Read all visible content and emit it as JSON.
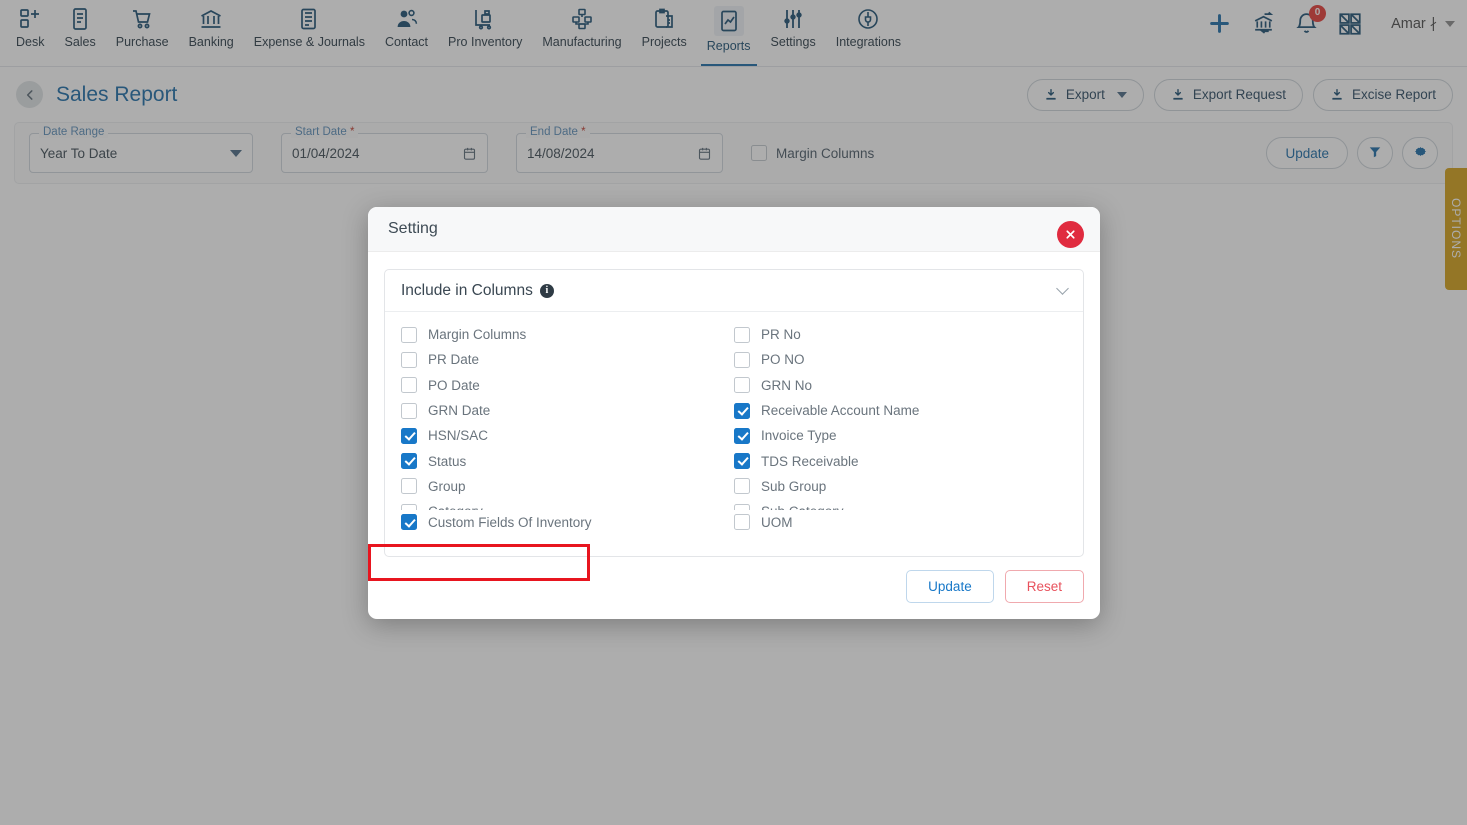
{
  "topnav": {
    "items": [
      {
        "label": "Desk",
        "icon": "desk-icon",
        "active": false
      },
      {
        "label": "Sales",
        "icon": "sales-icon",
        "active": false
      },
      {
        "label": "Purchase",
        "icon": "purchase-cart-icon",
        "active": false
      },
      {
        "label": "Banking",
        "icon": "bank-icon",
        "active": false
      },
      {
        "label": "Expense & Journals",
        "icon": "journal-icon",
        "active": false
      },
      {
        "label": "Contact",
        "icon": "contact-people-icon",
        "active": false
      },
      {
        "label": "Pro Inventory",
        "icon": "inventory-trolley-icon",
        "active": false
      },
      {
        "label": "Manufacturing",
        "icon": "manufacturing-icon",
        "active": false
      },
      {
        "label": "Projects",
        "icon": "projects-clipboard-icon",
        "active": false
      },
      {
        "label": "Reports",
        "icon": "reports-chart-icon",
        "active": true
      },
      {
        "label": "Settings",
        "icon": "settings-sliders-icon",
        "active": false
      },
      {
        "label": "Integrations",
        "icon": "integrations-plug-icon",
        "active": false
      }
    ],
    "right": {
      "add_icon": "plus-icon",
      "bank_icon": "bank-transfer-icon",
      "bell_icon": "bell-icon",
      "notification_count": "0",
      "apps_icon": "apps-grid-icon",
      "user_name": "Amar ∤",
      "user_caret": "chevron-down-icon"
    }
  },
  "page": {
    "back_icon": "chevron-left-icon",
    "title": "Sales Report",
    "actions": [
      {
        "label": "Export",
        "icon": "download-icon",
        "has_caret": true
      },
      {
        "label": "Export Request",
        "icon": "download-icon",
        "has_caret": false
      },
      {
        "label": "Excise Report",
        "icon": "download-icon",
        "has_caret": false
      }
    ]
  },
  "filters": {
    "date_range": {
      "label": "Date Range",
      "value": "Year To Date",
      "required": false
    },
    "start_date": {
      "label": "Start Date",
      "value": "01/04/2024",
      "required": true
    },
    "end_date": {
      "label": "End Date",
      "value": "14/08/2024",
      "required": true
    },
    "margin_columns": {
      "label": "Margin Columns",
      "checked": false
    },
    "update_label": "Update",
    "filter_icon": "funnel-icon",
    "settings_icon": "gear-icon"
  },
  "options_tab": {
    "label": "OPTIONS",
    "color": "#d4a017"
  },
  "modal": {
    "title": "Setting",
    "close_icon": "close-x-icon",
    "accordion": {
      "title": "Include in Columns",
      "info_icon": "info-icon",
      "info_glyph": "i",
      "chevron_icon": "chevron-down-icon"
    },
    "columns_left": [
      {
        "label": "Margin Columns",
        "checked": false
      },
      {
        "label": "PR Date",
        "checked": false
      },
      {
        "label": "PO Date",
        "checked": false
      },
      {
        "label": "GRN Date",
        "checked": false
      },
      {
        "label": "HSN/SAC",
        "checked": true
      },
      {
        "label": "Status",
        "checked": true
      },
      {
        "label": "Group",
        "checked": false
      },
      {
        "label": "Category",
        "checked": false
      }
    ],
    "columns_right": [
      {
        "label": "PR No",
        "checked": false
      },
      {
        "label": "PO NO",
        "checked": false
      },
      {
        "label": "GRN No",
        "checked": false
      },
      {
        "label": "Receivable Account Name",
        "checked": true
      },
      {
        "label": "Invoice Type",
        "checked": true
      },
      {
        "label": "TDS Receivable",
        "checked": true
      },
      {
        "label": "Sub Group",
        "checked": false
      },
      {
        "label": "Sub Category",
        "checked": false
      }
    ],
    "pinned_left": {
      "label": "Custom Fields Of Inventory",
      "checked": true
    },
    "pinned_right": {
      "label": "UOM",
      "checked": false
    },
    "highlight_color": "#e8151f",
    "footer": {
      "update_label": "Update",
      "reset_label": "Reset"
    }
  }
}
